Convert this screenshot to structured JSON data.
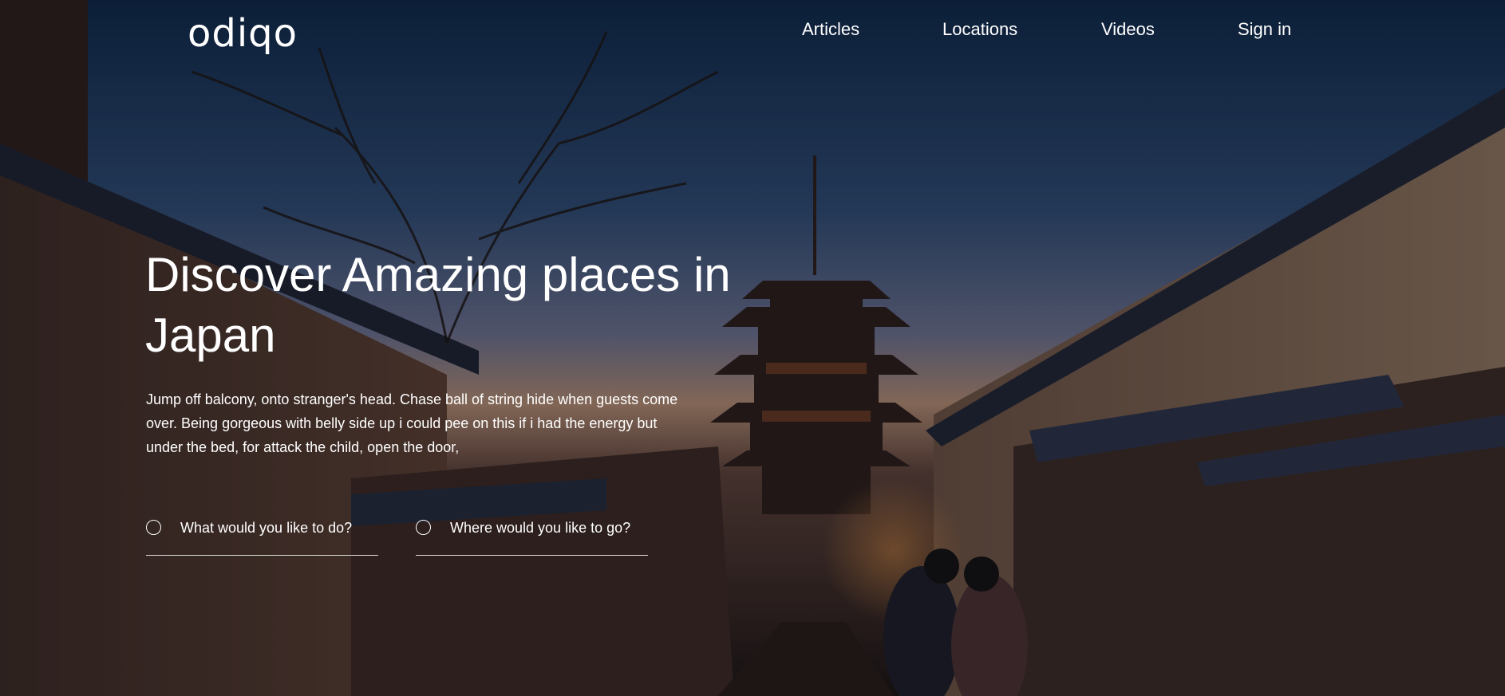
{
  "brand": {
    "logo_text": "odiqo"
  },
  "nav": {
    "items": [
      {
        "label": "Articles"
      },
      {
        "label": "Locations"
      },
      {
        "label": "Videos"
      },
      {
        "label": "Sign in"
      }
    ]
  },
  "hero": {
    "headline": "Discover Amazing places in Japan",
    "intro": "Jump off balcony, onto stranger's head. Chase ball of string hide when guests come over. Being gorgeous with belly side up i could pee on this if i had the energy but under the bed, for attack the child, open the door,",
    "search": {
      "activity_placeholder": "What would you like to do?",
      "location_placeholder": "Where would you like to go?"
    }
  },
  "colors": {
    "text": "#ffffff",
    "sky_top": "#0f2a4a",
    "sunset_glow": "#8e7a78"
  },
  "icons": {
    "activity_field_icon": "radio-circle-icon",
    "location_field_icon": "radio-circle-icon"
  }
}
